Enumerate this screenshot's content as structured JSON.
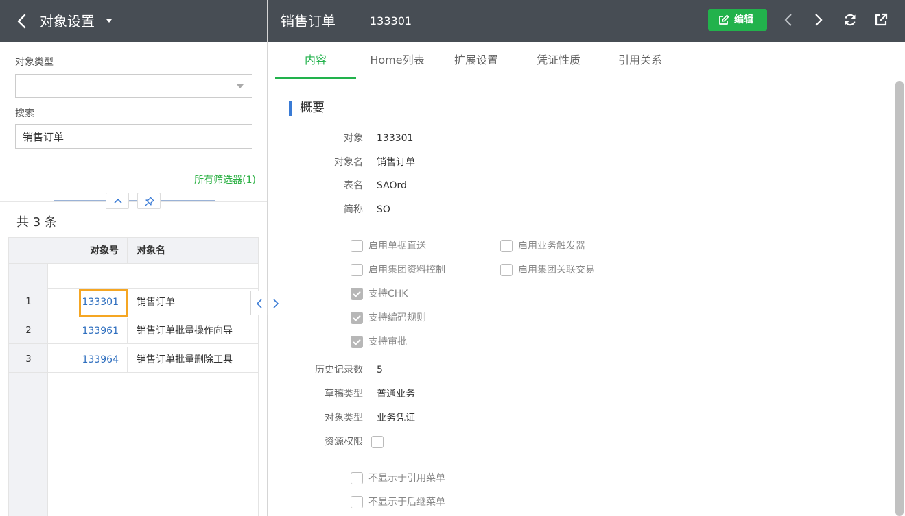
{
  "left": {
    "title": "对象设置",
    "object_type_label": "对象类型",
    "object_type_value": "",
    "search_label": "搜索",
    "search_value": "销售订单",
    "filters_link": "所有筛选器(1)",
    "count_text": "共 3 条",
    "grid": {
      "headers": {
        "code": "对象号",
        "name": "对象名"
      },
      "rows": [
        {
          "num": "1",
          "code": "133301",
          "name": "销售订单"
        },
        {
          "num": "2",
          "code": "133961",
          "name": "销售订单批量操作向导"
        },
        {
          "num": "3",
          "code": "133964",
          "name": "销售订单批量删除工具"
        }
      ]
    }
  },
  "right": {
    "title": "销售订单",
    "code": "133301",
    "edit_label": "编辑",
    "tabs": [
      "内容",
      "Home列表",
      "扩展设置",
      "凭证性质",
      "引用关系"
    ],
    "active_tab": "内容",
    "section_title": "概要",
    "fields": [
      {
        "label": "对象",
        "value": "133301"
      },
      {
        "label": "对象名",
        "value": "销售订单"
      },
      {
        "label": "表名",
        "value": "SAOrd"
      },
      {
        "label": "简称",
        "value": "SO"
      }
    ],
    "checkboxes": [
      {
        "label": "启用单据直送",
        "checked": false
      },
      {
        "label": "启用业务触发器",
        "checked": false
      },
      {
        "label": "启用集团资料控制",
        "checked": false
      },
      {
        "label": "启用集团关联交易",
        "checked": false
      },
      {
        "label": "支持CHK",
        "checked": true
      },
      {
        "label": "支持编码规则",
        "checked": true
      },
      {
        "label": "支持审批",
        "checked": true
      }
    ],
    "fields2": [
      {
        "label": "历史记录数",
        "value": "5"
      },
      {
        "label": "草稿类型",
        "value": "普通业务"
      },
      {
        "label": "对象类型",
        "value": "业务凭证"
      },
      {
        "label": "资源权限",
        "value": ""
      }
    ],
    "checkboxes2": [
      {
        "label": "不显示于引用菜单",
        "checked": false
      },
      {
        "label": "不显示于后继菜单",
        "checked": false
      }
    ]
  },
  "colors": {
    "header_bg": "#474d54",
    "accent_green": "#22b24c",
    "link_blue": "#2f6fbf",
    "highlight_orange": "#f5a623",
    "section_bar": "#3a7bd5"
  }
}
